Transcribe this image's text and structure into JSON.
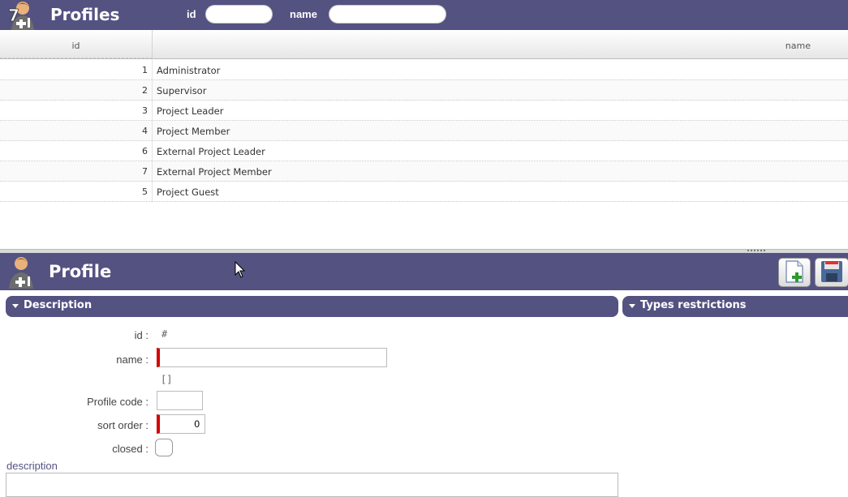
{
  "list": {
    "title": "Profiles",
    "filters": {
      "id_label": "id",
      "id_value": "",
      "name_label": "name",
      "name_value": ""
    },
    "columns": {
      "id": "id",
      "name": "name"
    },
    "rows": [
      {
        "id": "1",
        "name": "Administrator"
      },
      {
        "id": "2",
        "name": "Supervisor"
      },
      {
        "id": "3",
        "name": "Project Leader"
      },
      {
        "id": "4",
        "name": "Project Member"
      },
      {
        "id": "6",
        "name": "External Project Leader"
      },
      {
        "id": "7",
        "name": "External Project Member"
      },
      {
        "id": "5",
        "name": "Project Guest"
      }
    ]
  },
  "detail": {
    "title": "Profile",
    "toolbar": {
      "new_icon": "new-document-icon",
      "save_icon": "floppy-save-icon"
    },
    "sections": {
      "description": "Description",
      "types_restrictions": "Types restrictions"
    },
    "fields": {
      "id_label": "id :",
      "id_value": "#",
      "name_label": "name :",
      "name_value": "",
      "name_extra": "[]",
      "profile_code_label": "Profile code :",
      "profile_code_value": "",
      "sort_order_label": "sort order :",
      "sort_order_value": "0",
      "closed_label": "closed :",
      "closed_checked": false,
      "description_label": "description"
    }
  },
  "colors": {
    "header_bg": "#545281",
    "required_marker": "#d50000"
  }
}
